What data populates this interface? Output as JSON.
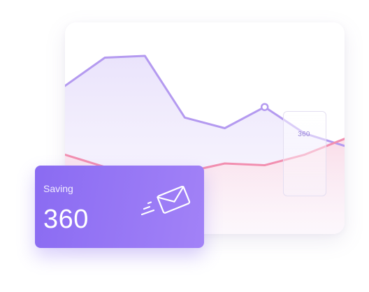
{
  "chart_data": {
    "type": "area",
    "title": "",
    "xlabel": "",
    "ylabel": "",
    "grid": false,
    "x": [
      0,
      1,
      2,
      3,
      4,
      5,
      6,
      7
    ],
    "ylim": [
      0,
      600
    ],
    "series": [
      {
        "color": "#b49af0",
        "fill": "#ece6fb",
        "values": [
          420,
          500,
          505,
          330,
          300,
          360,
          285,
          250
        ]
      },
      {
        "color": "#f28fb0",
        "fill": "#fde8ef",
        "values": [
          225,
          190,
          150,
          175,
          200,
          195,
          225,
          270
        ]
      }
    ],
    "highlight": {
      "series_index": 0,
      "point_index": 5,
      "label": "360"
    }
  },
  "saving_card": {
    "label": "Saving",
    "value": "360",
    "icon": "envelope-send-icon",
    "gradient": [
      "#8a6bf2",
      "#a282f7"
    ]
  }
}
